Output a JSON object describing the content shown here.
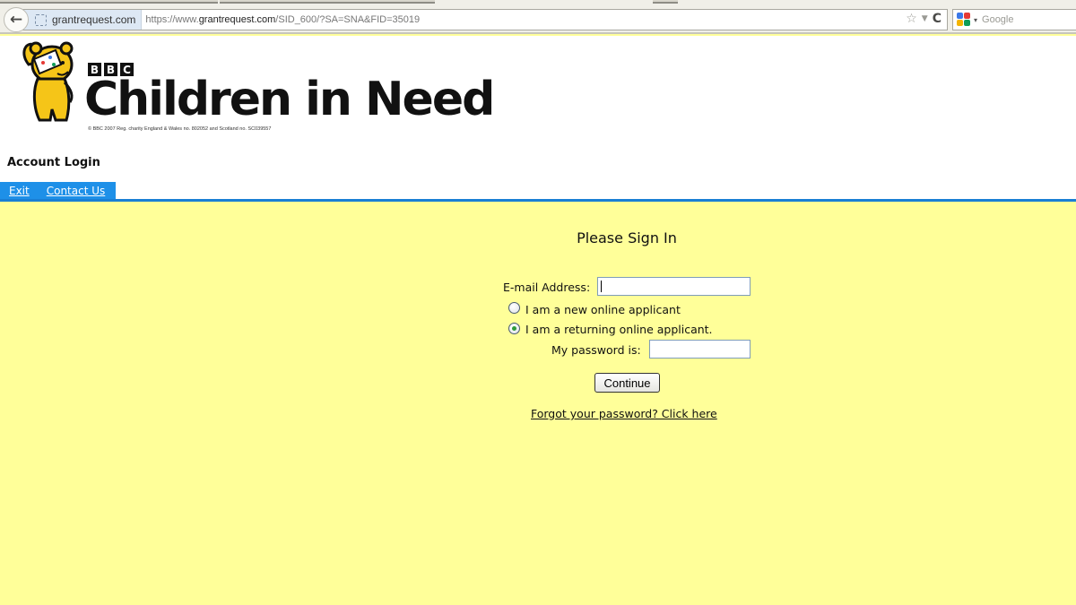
{
  "browser": {
    "site_identity": "grantrequest.com",
    "url_prefix": "https://www.",
    "url_domain": "grantrequest.com",
    "url_path": "/SID_600/?SA=SNA&FID=35019",
    "search_placeholder": "Google",
    "icons": {
      "back": "←",
      "bookmark_star": "☆",
      "dropdown": "▼",
      "reload": "C",
      "search_engine_dropdown": "▾"
    }
  },
  "header": {
    "logo": {
      "bbc_letters": [
        "B",
        "B",
        "C"
      ],
      "title": "Children in Need",
      "copyright": "© BBC 2007  Reg. charity England & Wales no. 802052  and Scotland no. SC039557"
    },
    "section_title": "Account Login",
    "nav": [
      {
        "label": "Exit"
      },
      {
        "label": "Contact Us"
      }
    ]
  },
  "form": {
    "title": "Please Sign In",
    "email_label": "E-mail Address:",
    "email_value": "",
    "options": [
      {
        "label": "I am a new online applicant",
        "checked": false
      },
      {
        "label": "I am a returning online applicant.",
        "checked": true
      }
    ],
    "password_label": "My password is:",
    "password_value": "",
    "continue_label": "Continue",
    "forgot_link": "Forgot your password? Click here"
  },
  "colors": {
    "page_background": "#ffff99",
    "nav_blue": "#1e90e8",
    "rule_blue": "#1a7fd4"
  }
}
